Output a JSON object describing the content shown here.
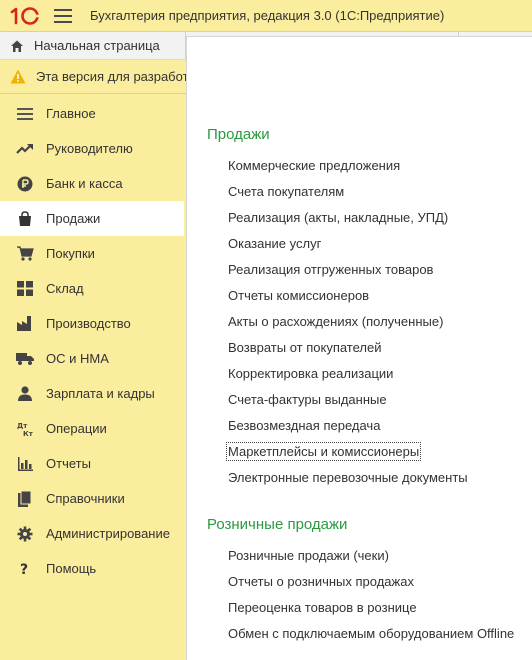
{
  "titlebar": {
    "logo_text": "1С",
    "title": "Бухгалтерия предприятия, редакция 3.0  (1С:Предприятие)"
  },
  "tabs": {
    "home": "Начальная страница",
    "version": "Эта версия для разработки"
  },
  "sidebar": {
    "items": [
      {
        "label": "Главное",
        "icon": "list-icon"
      },
      {
        "label": "Руководителю",
        "icon": "trend-icon"
      },
      {
        "label": "Банк и касса",
        "icon": "ruble-icon"
      },
      {
        "label": "Продажи",
        "icon": "bag-icon",
        "active": true
      },
      {
        "label": "Покупки",
        "icon": "cart-icon"
      },
      {
        "label": "Склад",
        "icon": "grid-icon"
      },
      {
        "label": "Производство",
        "icon": "factory-icon"
      },
      {
        "label": "ОС и НМА",
        "icon": "truck-icon"
      },
      {
        "label": "Зарплата и кадры",
        "icon": "person-icon"
      },
      {
        "label": "Операции",
        "icon": "dtkt-icon"
      },
      {
        "label": "Отчеты",
        "icon": "chart-icon"
      },
      {
        "label": "Справочники",
        "icon": "books-icon"
      },
      {
        "label": "Администрирование",
        "icon": "gear-icon"
      },
      {
        "label": "Помощь",
        "icon": "question-icon"
      }
    ]
  },
  "main": {
    "sections": [
      {
        "title": "Продажи",
        "items": [
          "Коммерческие предложения",
          "Счета покупателям",
          "Реализация (акты, накладные, УПД)",
          "Оказание услуг",
          "Реализация отгруженных товаров",
          "Отчеты комиссионеров",
          "Акты о расхождениях (полученные)",
          "Возвраты от покупателей",
          "Корректировка реализации",
          "Счета-фактуры выданные",
          "Безвозмездная передача",
          "Маркетплейсы и комиссионеры",
          "Электронные перевозочные документы"
        ]
      },
      {
        "title": "Розничные продажи",
        "items": [
          "Розничные продажи (чеки)",
          "Отчеты о розничных продажах",
          "Переоценка товаров в рознице",
          "Обмен с подключаемым оборудованием Offline"
        ]
      }
    ]
  },
  "colors": {
    "panel_yellow": "#fbed9e",
    "section_green": "#2a9a3f",
    "logo_red": "#d9251d"
  }
}
